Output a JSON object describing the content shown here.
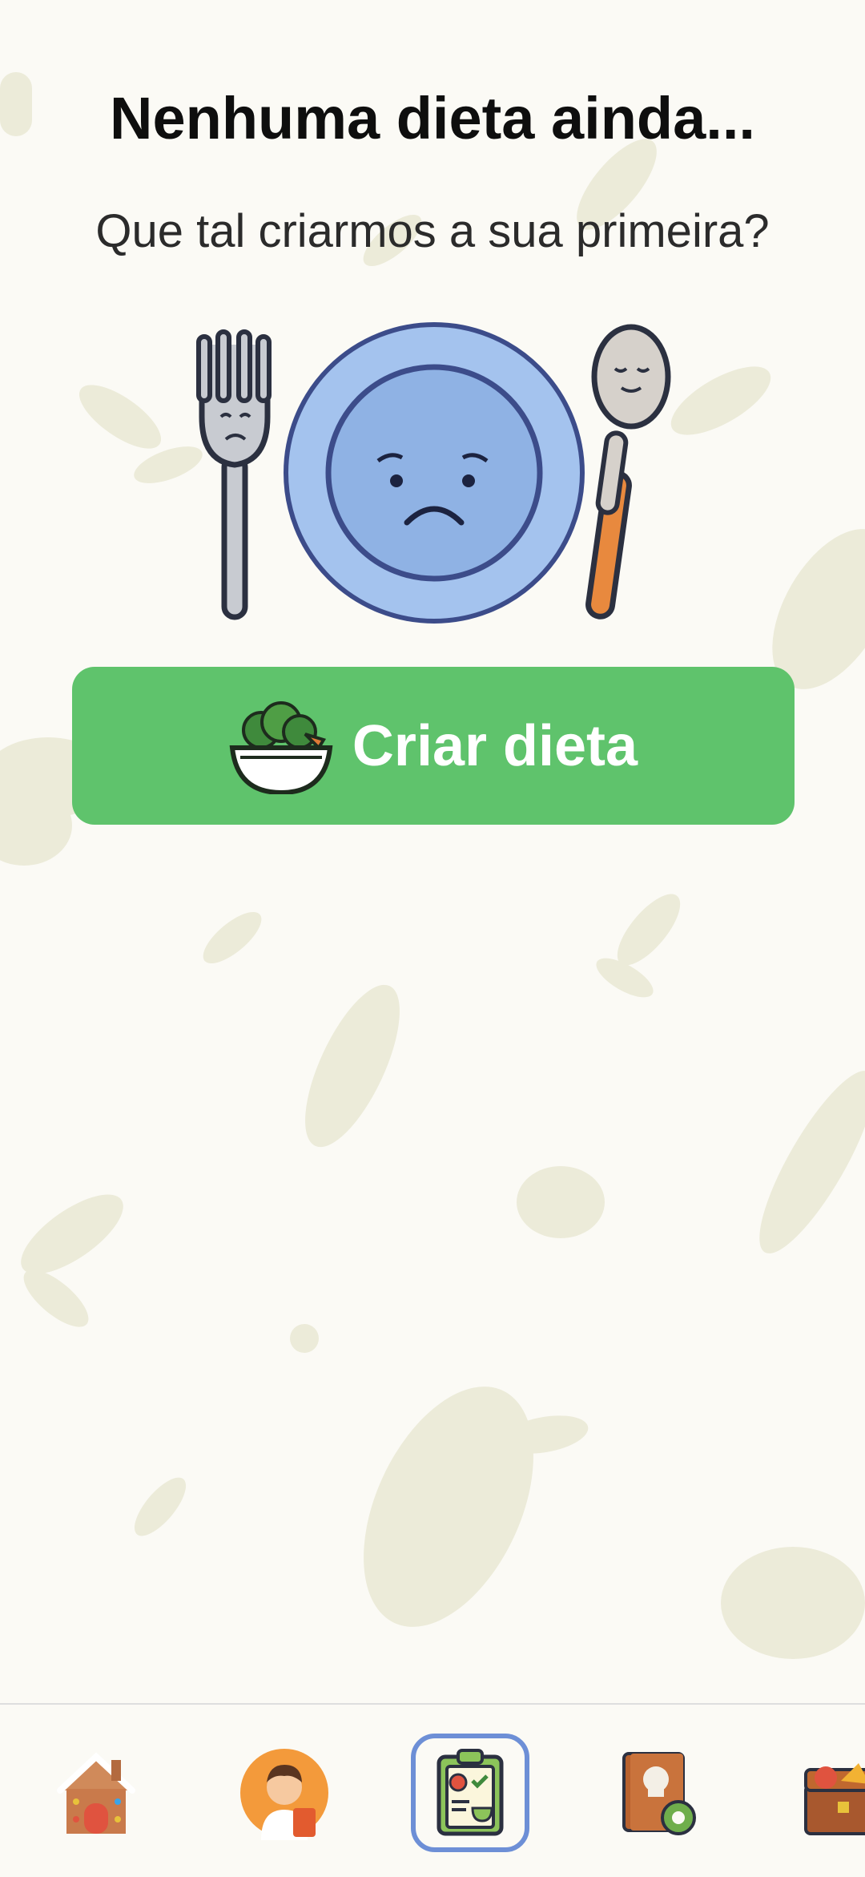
{
  "empty_state": {
    "title": "Nenhuma dieta ainda...",
    "subtitle": "Que tal criarmos a sua primeira?",
    "illustration_icon": "sad-plate-fork-spoon"
  },
  "cta": {
    "label": "Criar dieta",
    "icon": "salad-bowl-icon",
    "color": "#5fc36c"
  },
  "bottom_nav": {
    "active_index": 2,
    "active_color": "#6d8fd6",
    "items": [
      {
        "icon": "gingerbread-house-icon"
      },
      {
        "icon": "chef-avatar-icon"
      },
      {
        "icon": "diet-clipboard-icon"
      },
      {
        "icon": "recipe-book-gear-icon"
      },
      {
        "icon": "food-chest-icon"
      }
    ]
  },
  "colors": {
    "background": "#fbfaf5",
    "pattern": "#ecebd9",
    "title": "#0e0e0e"
  }
}
